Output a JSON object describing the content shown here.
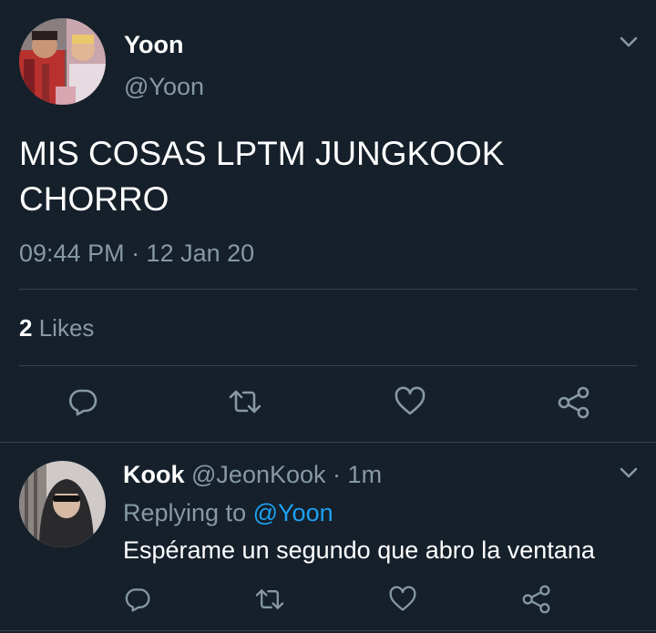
{
  "main_tweet": {
    "author_name": "Yoon",
    "author_handle": "@Yoon",
    "text_line1": "MIS COSAS LPTM JUNGKOOK",
    "text_line2": "CHORRO",
    "timestamp": "09:44 PM · 12 Jan 20",
    "likes_count": "2",
    "likes_label": "Likes"
  },
  "reply": {
    "author_name": "Kook",
    "author_handle": "@JeonKook",
    "separator": "·",
    "time": "1m",
    "replying_prefix": "Replying to",
    "replying_handle": "@Yoon",
    "text": "Espérame un segundo que abro la ventana"
  },
  "colors": {
    "background": "#15202b",
    "text": "#ffffff",
    "muted": "#8899a6",
    "link": "#1da1f2",
    "divider": "#38444d"
  },
  "icons": {
    "reply": "comment-icon",
    "retweet": "retweet-icon",
    "like": "heart-icon",
    "share": "share-icon",
    "menu": "chevron-down-icon"
  }
}
